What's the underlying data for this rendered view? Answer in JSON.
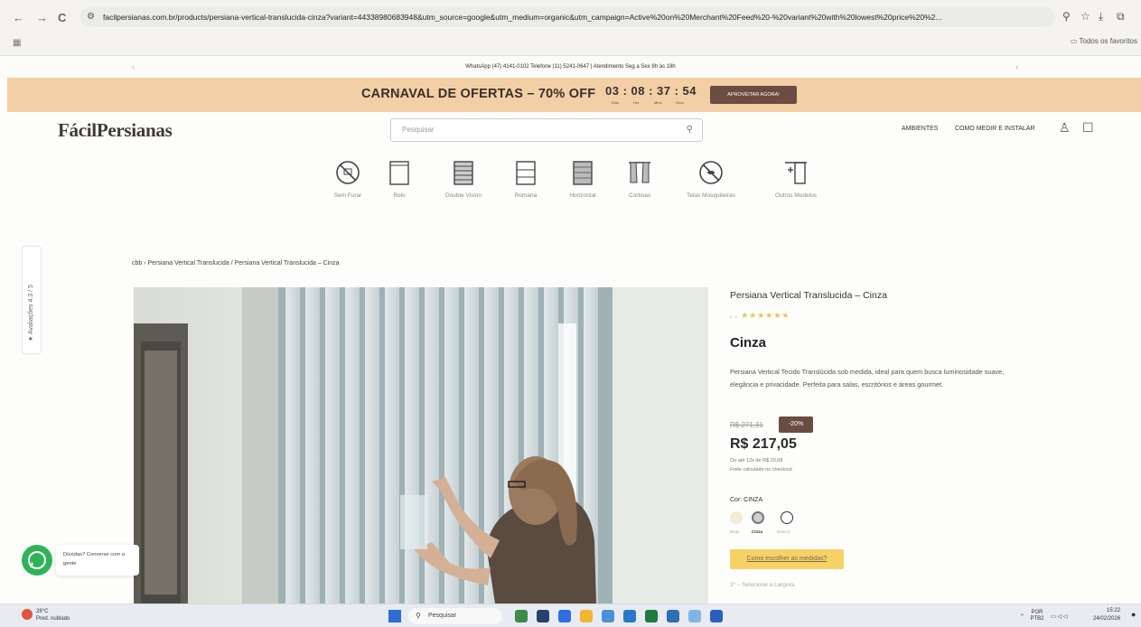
{
  "browser": {
    "url": "facilpersianas.com.br/products/persiana-vertical-translucida-cinza?variant=44338980683948&utm_source=google&utm_medium=organic&utm_campaign=Active%20on%20Merchant%20Feed%20-%20variant%20with%20lowest%20price%20%2...",
    "bookmarks_label": "Todos os favoritos"
  },
  "infobar": {
    "text": "WhatsApp (47) 4141-0102 Telefone (11) 5241-0647 | Atendimento Seg a Sex 8h às 18h"
  },
  "promo": {
    "text": "CARNAVAL DE OFERTAS – 70% OFF",
    "countdown": "03 : 08 : 37 : 54",
    "labels": [
      "Dias",
      "Hrs",
      "Mins",
      "Secs"
    ],
    "button": "APROVEITAR AGORA!"
  },
  "header": {
    "logo": "FácilPersianas",
    "search_placeholder": "Pesquisar",
    "nav": [
      "AMBIENTES",
      "COMO MEDIR E INSTALAR"
    ]
  },
  "categories": [
    {
      "label": "Sem Furar",
      "icon": "no-drill-icon"
    },
    {
      "label": "Rolo",
      "icon": "roller-blind-icon"
    },
    {
      "label": "Double Vision",
      "icon": "double-vision-icon"
    },
    {
      "label": "Romana",
      "icon": "roman-blind-icon"
    },
    {
      "label": "Horizontal",
      "icon": "horizontal-blind-icon"
    },
    {
      "label": "Cortinas",
      "icon": "curtain-icon"
    },
    {
      "label": "Telas Mosquiteiras",
      "icon": "mosquito-net-icon"
    },
    {
      "label": "Outros Modelos",
      "icon": "other-models-icon"
    }
  ],
  "reviews_tab": "★ Avaliações 4.3 / 5",
  "breadcrumb": "cbb › Persiana Vertical Translucida / Persiana Vertical Translucida – Cinza",
  "product": {
    "title": "Persiana Vertical Translucida – Cinza",
    "rating_text": "5.0",
    "stars": "★★★★★★",
    "color_heading": "Cinza",
    "description": "Persiana Vertical Tecido Translúcida sob medida, ideal para quem busca luminosidade suave, elegância e privacidade. Perfeita para salas, escritórios e áreas gourmet.",
    "old_price": "R$ 271,31",
    "discount": "-20%",
    "price": "R$ 217,05",
    "installments": "Ou até 12x de R$ 20,08",
    "shipping": "Frete calculado no checkout",
    "color_label": "Cor: CINZA",
    "swatches": [
      {
        "name": "Bege",
        "color": "#f1ecd9"
      },
      {
        "name": "Cinza",
        "color": "#cfcfcf"
      },
      {
        "name": "Branco",
        "color": "#ffffff"
      }
    ],
    "measure_button": "Como escolher as medidas?",
    "step_label": "1º – Selecione a Largura"
  },
  "whatsapp": {
    "text": "Dúvidas? Converse com a gente"
  },
  "taskbar": {
    "temp": "28°C",
    "weather": "Pred. nublado",
    "search": "Pesquisar",
    "lang": "POR",
    "layout": "PTB2",
    "time": "15:22",
    "date": "24/02/2026"
  }
}
